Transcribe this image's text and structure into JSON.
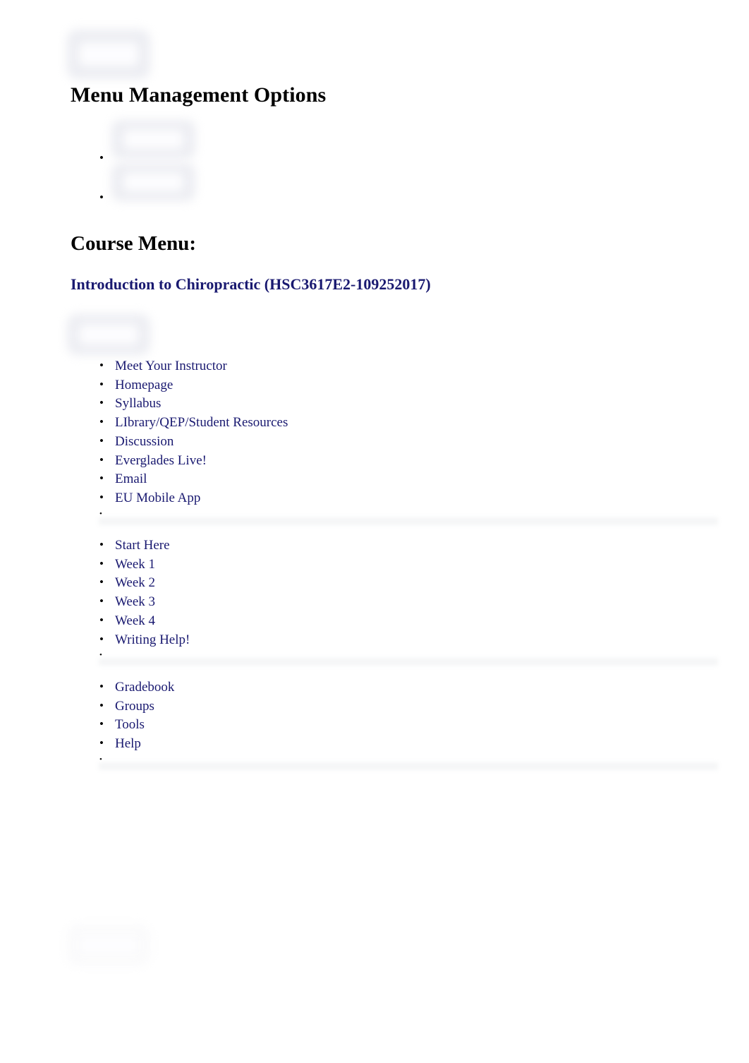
{
  "document": {
    "title": "Menu Management Options",
    "section_heading": "Course Menu:",
    "course_link": "Introduction to Chiropractic (HSC3617E2-109252017)"
  },
  "colors": {
    "link": "#191970",
    "heading": "#000000",
    "background": "#ffffff",
    "redaction_chip": "#e9eaf0",
    "separator": "#f4f5f6"
  },
  "top_bullets": [
    {
      "label": "",
      "redacted": true
    },
    {
      "label": "",
      "redacted": true
    }
  ],
  "redacted_chips": [
    {
      "name": "header-image-placeholder"
    },
    {
      "name": "bullet-image-placeholder-1"
    },
    {
      "name": "bullet-image-placeholder-2"
    },
    {
      "name": "course-menu-image-placeholder"
    },
    {
      "name": "footer-image-placeholder"
    }
  ],
  "course_menu": {
    "group_1": [
      {
        "label": "Meet Your Instructor"
      },
      {
        "label": "Homepage"
      },
      {
        "label": "Syllabus"
      },
      {
        "label": "LIbrary/QEP/Student Resources"
      },
      {
        "label": "Discussion"
      },
      {
        "label": "Everglades Live!"
      },
      {
        "label": "Email"
      },
      {
        "label": "EU Mobile App"
      },
      {
        "label": ""
      }
    ],
    "group_2": [
      {
        "label": "Start Here"
      },
      {
        "label": "Week 1"
      },
      {
        "label": "Week 2"
      },
      {
        "label": "Week 3"
      },
      {
        "label": "Week 4"
      },
      {
        "label": "Writing Help!"
      },
      {
        "label": ""
      }
    ],
    "group_3": [
      {
        "label": "Gradebook"
      },
      {
        "label": "Groups"
      },
      {
        "label": "Tools"
      },
      {
        "label": "Help"
      },
      {
        "label": ""
      }
    ]
  }
}
